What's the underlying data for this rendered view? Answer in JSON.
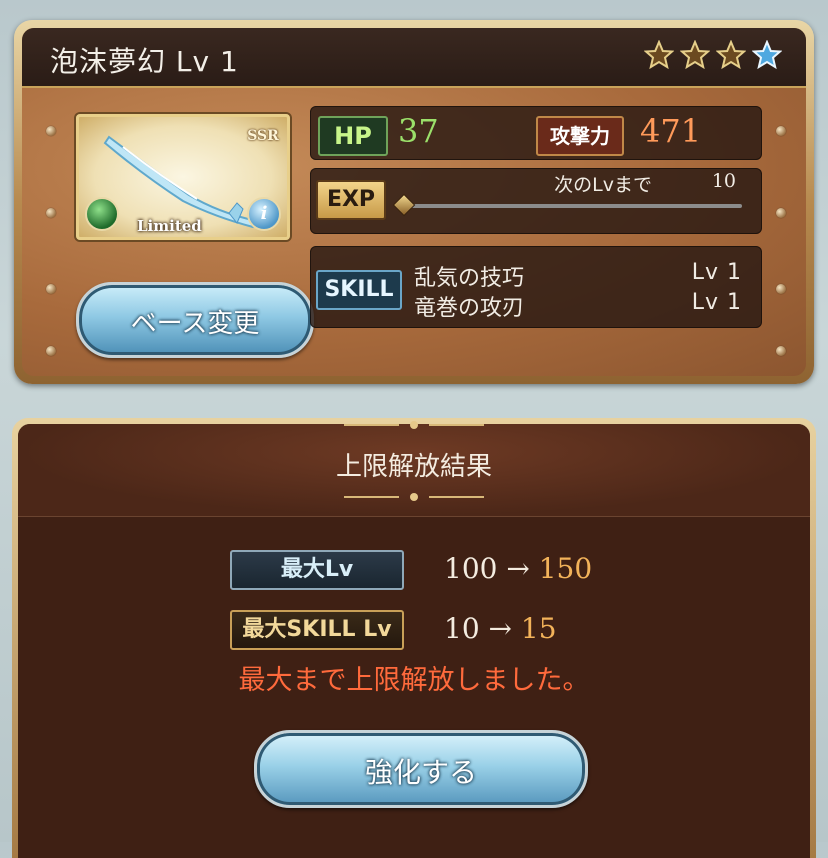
{
  "weapon": {
    "name": "泡沫夢幻 Lv 1",
    "rarity_badge": "SSR",
    "limited_label": "Limited",
    "element_icon": "wind-element-icon",
    "info_icon": "info-icon",
    "stars_filled": 3,
    "stars_total": 4
  },
  "buttons": {
    "base_change": "ベース変更",
    "enhance": "強化する"
  },
  "stats": {
    "hp_label": "HP",
    "hp_value": "37",
    "atk_label": "攻撃力",
    "atk_value": "471",
    "exp_label": "EXP",
    "next_lv_label": "次のLvまで",
    "next_lv_value": "10",
    "exp_progress": 0
  },
  "skills": {
    "label": "SKILL",
    "items": [
      {
        "name": "乱気の技巧",
        "level": "Lv 1"
      },
      {
        "name": "竜巻の攻刃",
        "level": "Lv 1"
      }
    ]
  },
  "result": {
    "title": "上限解放結果",
    "max_lv_label": "最大Lv",
    "max_lv_old": "100 →",
    "max_lv_new": "150",
    "max_skill_label": "最大SKILL Lv",
    "max_skill_old": "10 →",
    "max_skill_new": "15",
    "message": "最大まで上限解放しました。"
  },
  "colors": {
    "hp_value": "#9be06a",
    "atk_value": "#ff9a5a",
    "new_value": "#f3b35a",
    "message": "#ff6a3c"
  }
}
